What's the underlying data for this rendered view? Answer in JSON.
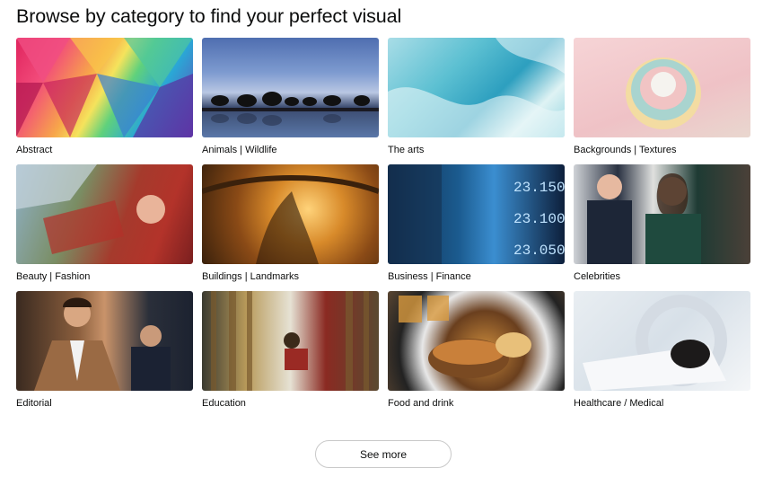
{
  "page": {
    "title": "Browse by category to find your perfect visual",
    "see_more_label": "See more"
  },
  "categories": [
    {
      "label": "Abstract",
      "icon": "abstract-thumbnail"
    },
    {
      "label": "Animals | Wildlife",
      "icon": "animals-thumbnail"
    },
    {
      "label": "The arts",
      "icon": "arts-thumbnail"
    },
    {
      "label": "Backgrounds | Textures",
      "icon": "backgrounds-thumbnail"
    },
    {
      "label": "Beauty | Fashion",
      "icon": "beauty-thumbnail"
    },
    {
      "label": "Buildings | Landmarks",
      "icon": "buildings-thumbnail"
    },
    {
      "label": "Business | Finance",
      "icon": "business-thumbnail"
    },
    {
      "label": "Celebrities",
      "icon": "celebrities-thumbnail"
    },
    {
      "label": "Editorial",
      "icon": "editorial-thumbnail"
    },
    {
      "label": "Education",
      "icon": "education-thumbnail"
    },
    {
      "label": "Food and drink",
      "icon": "food-thumbnail"
    },
    {
      "label": "Healthcare / Medical",
      "icon": "medical-thumbnail"
    }
  ],
  "thumb_overlays": {
    "business_numbers": [
      "23.150",
      "23.100",
      "23.050"
    ]
  }
}
